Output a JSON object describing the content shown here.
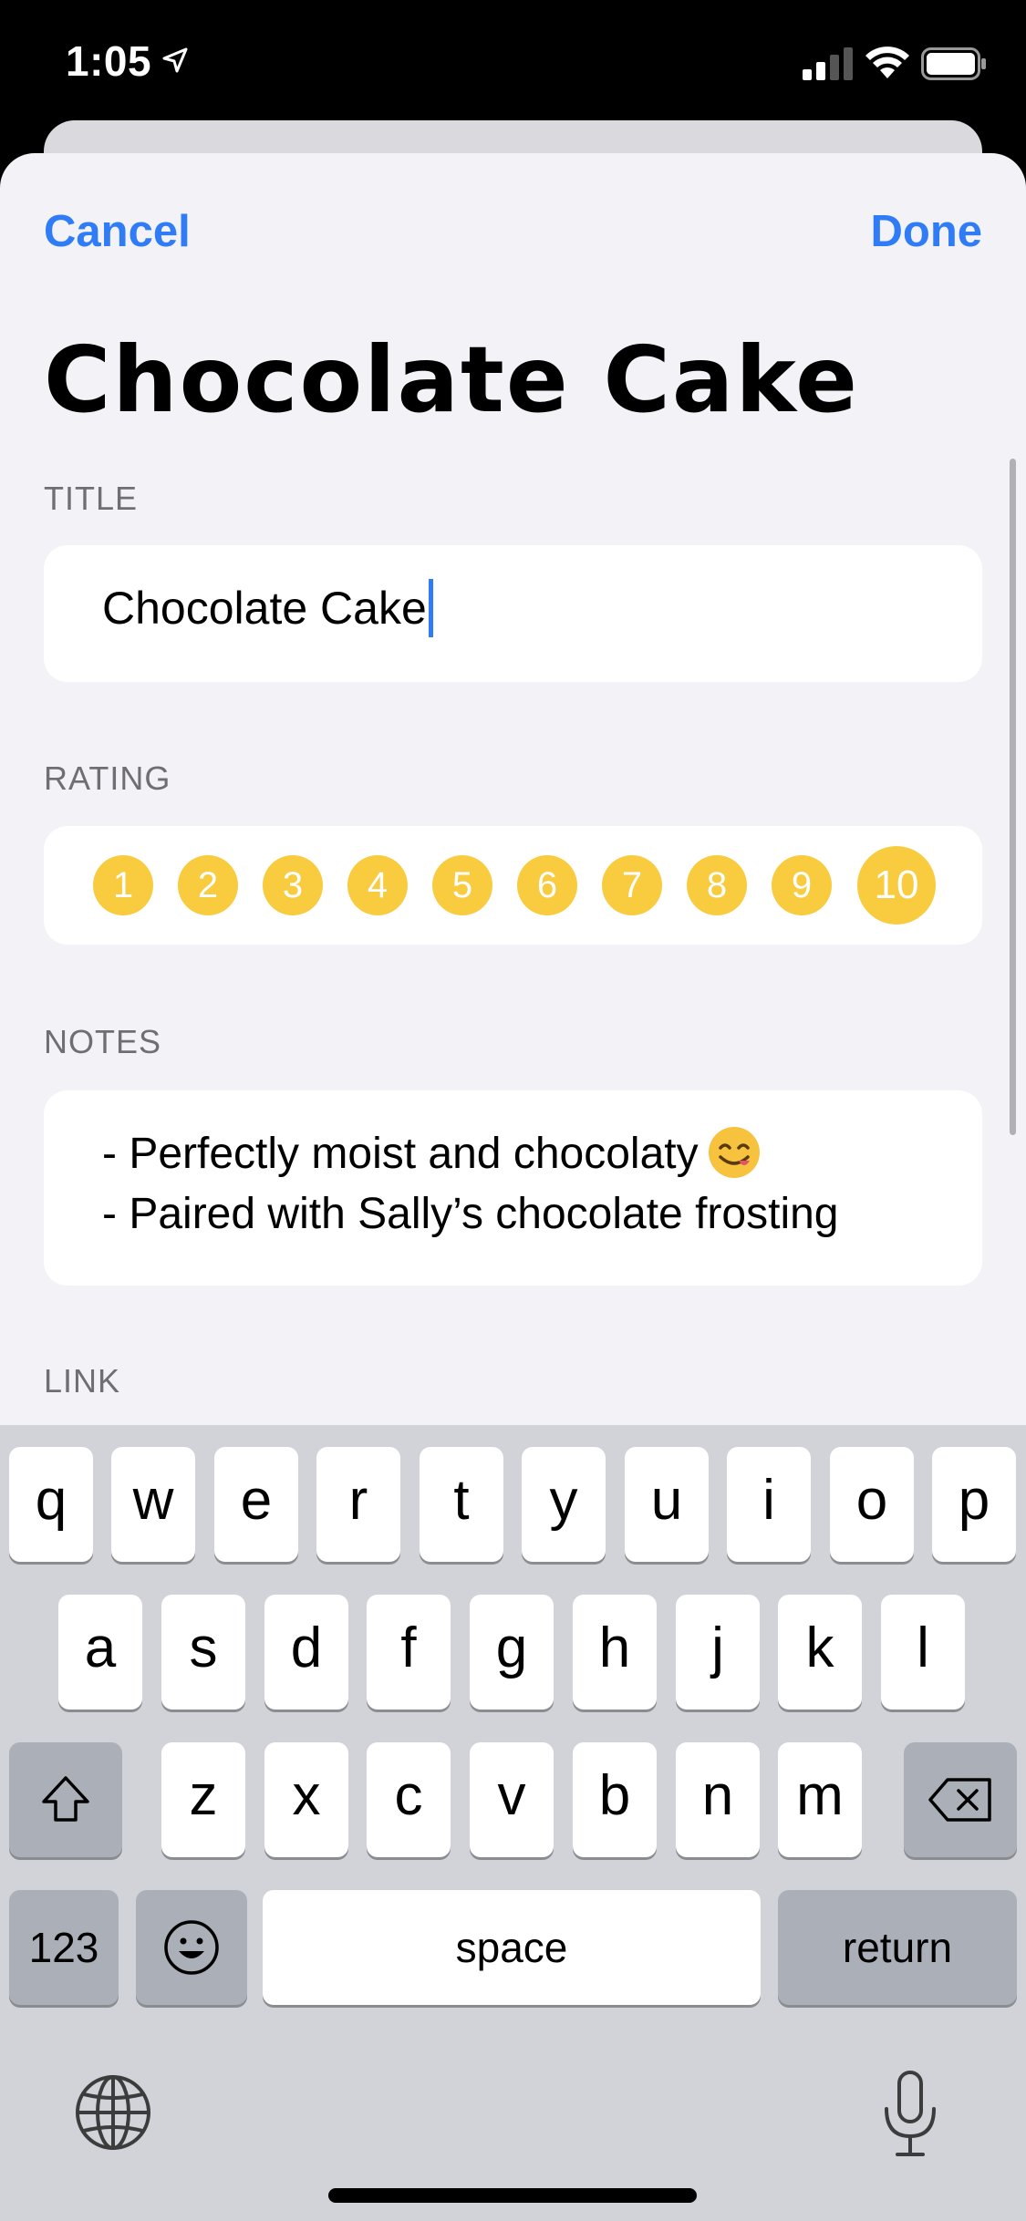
{
  "status_bar": {
    "time": "1:05"
  },
  "nav": {
    "cancel_label": "Cancel",
    "done_label": "Done"
  },
  "page_title": "Chocolate Cake",
  "title_section": {
    "label": "TITLE",
    "value": "Chocolate Cake"
  },
  "rating_section": {
    "label": "RATING",
    "options": [
      "1",
      "2",
      "3",
      "4",
      "5",
      "6",
      "7",
      "8",
      "9",
      "10"
    ],
    "selected": "10",
    "dot_color": "#f9cb3f"
  },
  "notes_section": {
    "label": "NOTES",
    "lines": [
      "- Perfectly moist and chocolaty",
      "- Paired with Sally’s chocolate frosting"
    ]
  },
  "link_section": {
    "label": "LINK"
  },
  "keyboard": {
    "row1": [
      "q",
      "w",
      "e",
      "r",
      "t",
      "y",
      "u",
      "i",
      "o",
      "p"
    ],
    "row2": [
      "a",
      "s",
      "d",
      "f",
      "g",
      "h",
      "j",
      "k",
      "l"
    ],
    "row3": [
      "z",
      "x",
      "c",
      "v",
      "b",
      "n",
      "m"
    ],
    "numbers_label": "123",
    "space_label": "space",
    "return_label": "return"
  },
  "colors": {
    "accent": "#2f7cf6",
    "background": "#f2f2f7",
    "rating": "#f9cb3f"
  }
}
